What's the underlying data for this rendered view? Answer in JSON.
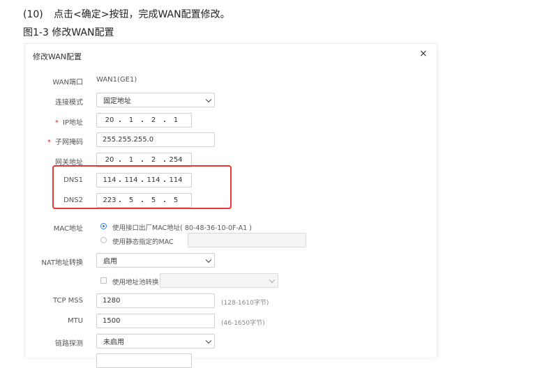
{
  "doc": {
    "step_number": "(10)",
    "step_text": "点击<确定>按钮，完成WAN配置修改。",
    "figure_caption": "图1-3 修改WAN配置"
  },
  "dialog": {
    "title": "修改WAN配置",
    "close_icon": "×",
    "fields": {
      "wan_port": {
        "label": "WAN端口",
        "value": "WAN1(GE1)"
      },
      "conn_mode": {
        "label": "连接模式",
        "value": "固定地址"
      },
      "ip": {
        "required": "*",
        "label": "IP地址",
        "octets": [
          "20",
          "1",
          "2",
          "1"
        ]
      },
      "mask": {
        "required": "*",
        "label": "子网掩码",
        "value": "255.255.255.0"
      },
      "gateway": {
        "label": "网关地址",
        "octets": [
          "20",
          "1",
          "2",
          "254"
        ]
      },
      "dns1": {
        "label": "DNS1",
        "octets": [
          "114",
          "114",
          "114",
          "114"
        ]
      },
      "dns2": {
        "label": "DNS2",
        "octets": [
          "223",
          "5",
          "5",
          "5"
        ]
      },
      "mac": {
        "label": "MAC地址",
        "option1": "使用接口出厂MAC地址( 80-48-36-10-0F-A1 )",
        "option2": "使用静态指定的MAC",
        "selected": "option1"
      },
      "nat": {
        "label": "NAT地址转换",
        "value": "启用",
        "pool_label": "使用地址池转换",
        "pool_value": ""
      },
      "tcp_mss": {
        "label": "TCP MSS",
        "value": "1280",
        "hint": "(128-1610字节)"
      },
      "mtu": {
        "label": "MTU",
        "value": "1500",
        "hint": "(46-1650字节)"
      },
      "link_detect": {
        "label": "链路探测",
        "value": "未启用"
      }
    }
  },
  "highlight_color": "#e53935",
  "accent_color": "#2d7be5"
}
